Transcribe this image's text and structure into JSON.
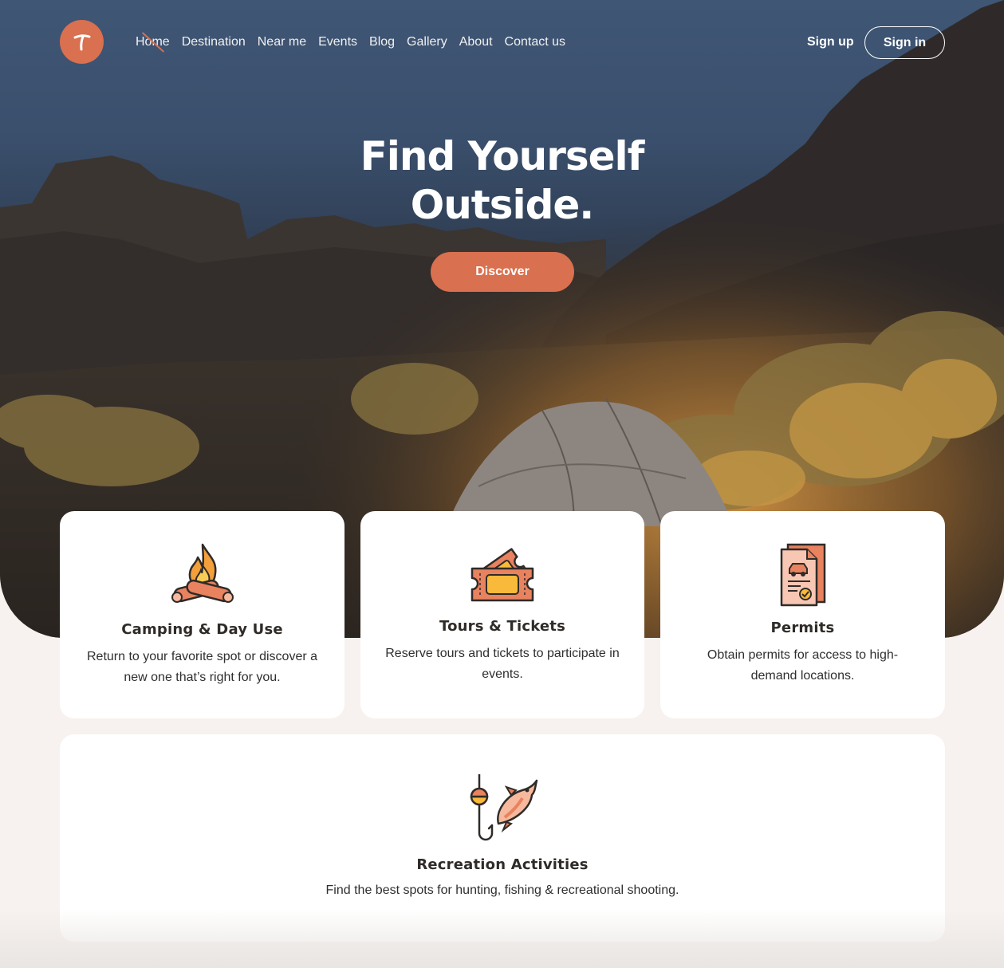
{
  "nav": {
    "links": [
      "Home",
      "Destination",
      "Near me",
      "Events",
      "Blog",
      "Gallery",
      "About",
      "Contact us"
    ],
    "active": "Home",
    "signup_label": "Sign up",
    "signin_label": "Sign in"
  },
  "hero": {
    "title_line1": "Find Yourself",
    "title_line2": "Outside.",
    "cta_label": "Discover"
  },
  "cards": [
    {
      "title": "Camping & Day Use",
      "text": "Return to your favorite spot or discover a new one that’s right for you.",
      "icon": "campfire-icon"
    },
    {
      "title": "Tours & Tickets",
      "text": "Reserve tours and tickets to participate in events.",
      "icon": "ticket-icon"
    },
    {
      "title": "Permits",
      "text": "Obtain permits for access to high-demand locations.",
      "icon": "permit-document-icon"
    },
    {
      "title": "Recreation Activities",
      "text": "Find the best spots for hunting, fishing & recreational shooting.",
      "icon": "fishing-hook-icon"
    }
  ],
  "colors": {
    "accent": "#d9704f",
    "icon_orange": "#e8825f",
    "icon_yellow": "#f9b93a",
    "icon_outline": "#2f2b28"
  }
}
